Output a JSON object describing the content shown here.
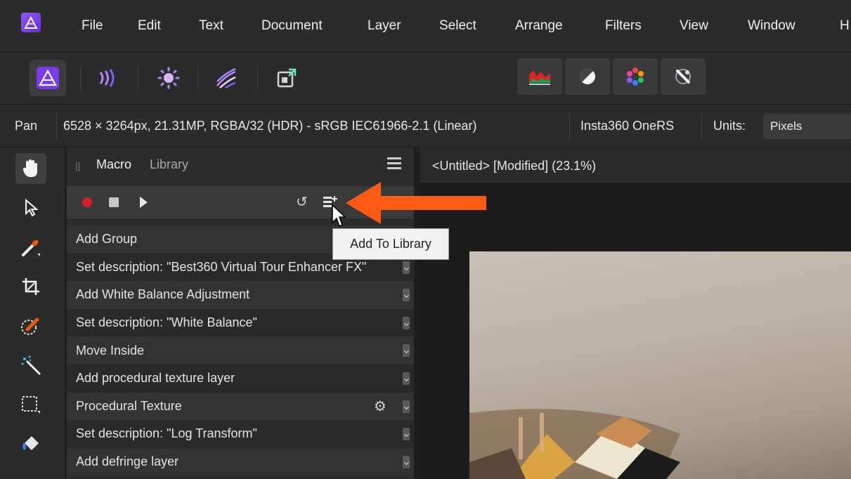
{
  "menu": {
    "items": [
      "File",
      "Edit",
      "Text",
      "Document",
      "Layer",
      "Select",
      "Arrange",
      "Filters",
      "View",
      "Window",
      "H"
    ]
  },
  "toolbar": {
    "personas": [
      "photo-persona-icon",
      "liquify-persona-icon",
      "develop-persona-icon",
      "tone-mapping-persona-icon",
      "export-persona-icon"
    ],
    "quick_buttons": [
      "histogram-icon",
      "mask-toggle-icon",
      "color-wheel-icon",
      "eyedropper-icon"
    ]
  },
  "context": {
    "tool": "Pan",
    "doc_info": "6528 × 3264px, 21.31MP, RGBA/32 (HDR) - sRGB IEC61966-2.1 (Linear)",
    "camera": "Insta360 OneRS",
    "units_label": "Units:",
    "units_value": "Pixels"
  },
  "tools": [
    "hand-tool-icon",
    "move-tool-icon",
    "brush-tool-icon",
    "crop-tool-icon",
    "selection-brush-icon",
    "magic-wand-icon",
    "marquee-tool-icon",
    "fill-tool-icon"
  ],
  "panel": {
    "tabs": [
      "Macro",
      "Library"
    ],
    "tooltip": "Add To Library",
    "rows": [
      {
        "label": "Add Group",
        "gear": false
      },
      {
        "label": "Set description: \"Best360 Virtual Tour Enhancer FX\"",
        "gear": false
      },
      {
        "label": "Add White Balance Adjustment",
        "gear": false
      },
      {
        "label": "Set description: \"White Balance\"",
        "gear": false
      },
      {
        "label": "Move Inside",
        "gear": false
      },
      {
        "label": "Add procedural texture layer",
        "gear": false
      },
      {
        "label": "Procedural Texture",
        "gear": true
      },
      {
        "label": "Set description: \"Log Transform\"",
        "gear": false
      },
      {
        "label": "Add defringe layer",
        "gear": false
      }
    ]
  },
  "document": {
    "title": "<Untitled> [Modified] (23.1%)"
  },
  "colors": {
    "accent_arrow": "#ff5a14",
    "record": "#d2202f",
    "brand": "#7c3aed"
  }
}
